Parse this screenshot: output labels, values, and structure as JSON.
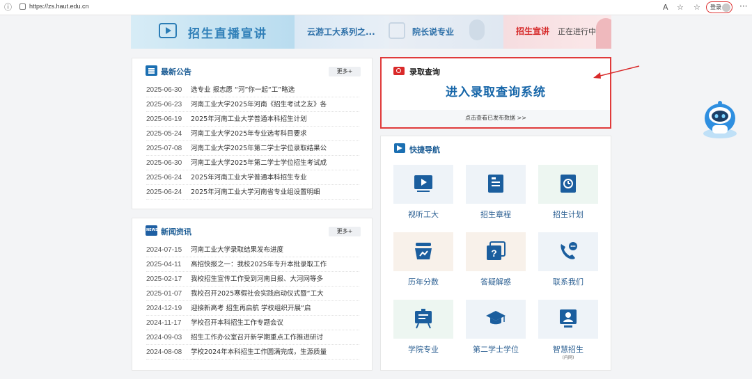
{
  "browser": {
    "url": "https://zs.haut.edu.cn",
    "login_label": "登录",
    "more_glyph": "···"
  },
  "banner": {
    "live": "招生直播宣讲",
    "cloud": "云游工大系列之...",
    "president": "院长说专业",
    "status_red": "招生宣讲",
    "status_rest": "正在进行中..."
  },
  "notice": {
    "title": "最新公告",
    "more": "更多+",
    "items": [
      {
        "date": "2025-06-30",
        "title": "选专业 报志愿 “河”你一起“工”略选"
      },
      {
        "date": "2025-06-23",
        "title": "河南工业大学2025年河南《招生考试之友》各"
      },
      {
        "date": "2025-06-19",
        "title": "2025年河南工业大学普通本科招生计划"
      },
      {
        "date": "2025-05-24",
        "title": "河南工业大学2025年专业选考科目要求"
      },
      {
        "date": "2025-07-08",
        "title": "河南工业大学2025年第二学士学位录取结果公"
      },
      {
        "date": "2025-06-30",
        "title": "河南工业大学2025年第二学士学位招生考试成"
      },
      {
        "date": "2025-06-24",
        "title": "2025年河南工业大学普通本科招生专业"
      },
      {
        "date": "2025-06-24",
        "title": "2025年河南工业大学河南省专业组设置明细"
      }
    ]
  },
  "news": {
    "title": "新闻资讯",
    "more": "更多+",
    "items": [
      {
        "date": "2024-07-15",
        "title": "河南工业大学录取结果发布进度"
      },
      {
        "date": "2025-04-11",
        "title": "高招快报之一：我校2025年专升本批录取工作"
      },
      {
        "date": "2025-02-17",
        "title": "我校招生宣传工作受到河南日报、大河网等多"
      },
      {
        "date": "2025-01-07",
        "title": "我校召开2025寒假社会实践启动仪式暨“工大"
      },
      {
        "date": "2024-12-19",
        "title": "迎接新高考 招生再启航 学校组织开展“启"
      },
      {
        "date": "2024-11-17",
        "title": "学校召开本科招生工作专题会议"
      },
      {
        "date": "2024-09-03",
        "title": "招生工作办公室召开新学期重点工作推进研讨"
      },
      {
        "date": "2024-08-08",
        "title": "学校2024年本科招生工作圆满完成，生源质量"
      }
    ]
  },
  "query": {
    "title": "录取查询",
    "main": "进入录取查询系统",
    "sub": "点击查看已发布数据 >>"
  },
  "nav": {
    "title": "快捷导航",
    "tiles": [
      {
        "label": "视听工大",
        "icon": "video-icon",
        "sub": ""
      },
      {
        "label": "招生章程",
        "icon": "book-icon",
        "sub": ""
      },
      {
        "label": "招生计划",
        "icon": "clock-book-icon",
        "sub": ""
      },
      {
        "label": "历年分数",
        "icon": "chart-basket-icon",
        "sub": ""
      },
      {
        "label": "答疑解惑",
        "icon": "question-icon",
        "sub": ""
      },
      {
        "label": "联系我们",
        "icon": "phone-chat-icon",
        "sub": ""
      },
      {
        "label": "学院专业",
        "icon": "board-icon",
        "sub": ""
      },
      {
        "label": "第二学士学位",
        "icon": "graduation-cap-icon",
        "sub": ""
      },
      {
        "label": "智慧招生",
        "icon": "person-board-icon",
        "sub": "(内网)"
      }
    ]
  },
  "colors": {
    "brand_blue": "#1b6fb2",
    "highlight_red": "#e03a3a",
    "link_blue": "#2b5f92"
  }
}
